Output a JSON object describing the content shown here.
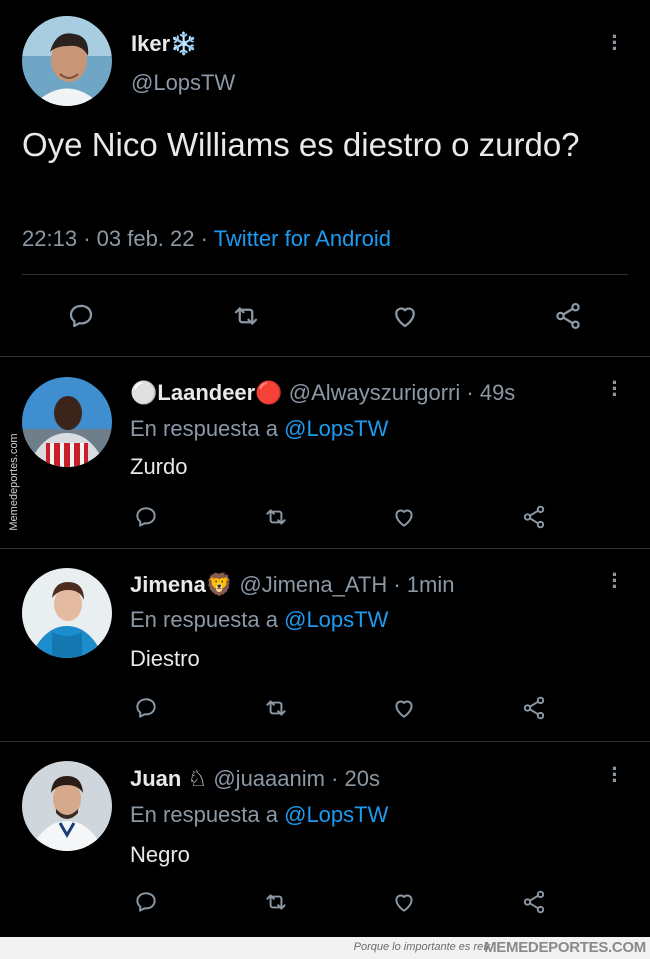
{
  "main_tweet": {
    "avatar_alt": "profile photo",
    "name": "Iker",
    "name_emoji": "❄️",
    "handle": "@LopsTW",
    "text": "Oye Nico Williams es diestro o zurdo?",
    "time": "22:13",
    "date": "03 feb. 22",
    "separator": "·",
    "source": "Twitter for Android",
    "more_icon": "more-vertical-icon"
  },
  "actions": {
    "icons": [
      "reply-icon",
      "retweet-icon",
      "like-icon",
      "share-icon"
    ]
  },
  "replies": [
    {
      "name_prefix": "⚪",
      "name": "Laandeer",
      "name_suffix": "🔴",
      "handle": "@Alwayszurigorri",
      "time": "49s",
      "replying_label": "En respuesta a",
      "mention": "@LopsTW",
      "text": "Zurdo"
    },
    {
      "name_prefix": "",
      "name": "Jimena",
      "name_suffix": "🦁",
      "handle": "@Jimena_ATH",
      "time": "1min",
      "replying_label": "En respuesta a",
      "mention": "@LopsTW",
      "text": "Diestro"
    },
    {
      "name_prefix": "",
      "name": "Juan",
      "name_suffix": "♘",
      "handle": "@juaaanim",
      "time": "20s",
      "replying_label": "En respuesta a",
      "mention": "@LopsTW",
      "text": "Negro"
    }
  ],
  "watermark": {
    "side_text": "Memedeportes.com",
    "slogan": "Porque lo importante es reír",
    "brand": "MEMEDEPORTES.COM"
  },
  "colors": {
    "background": "#000000",
    "text": "#e7e9ea",
    "secondary": "#8b98a5",
    "accent": "#1d9bf0",
    "divider": "#2f3336"
  }
}
